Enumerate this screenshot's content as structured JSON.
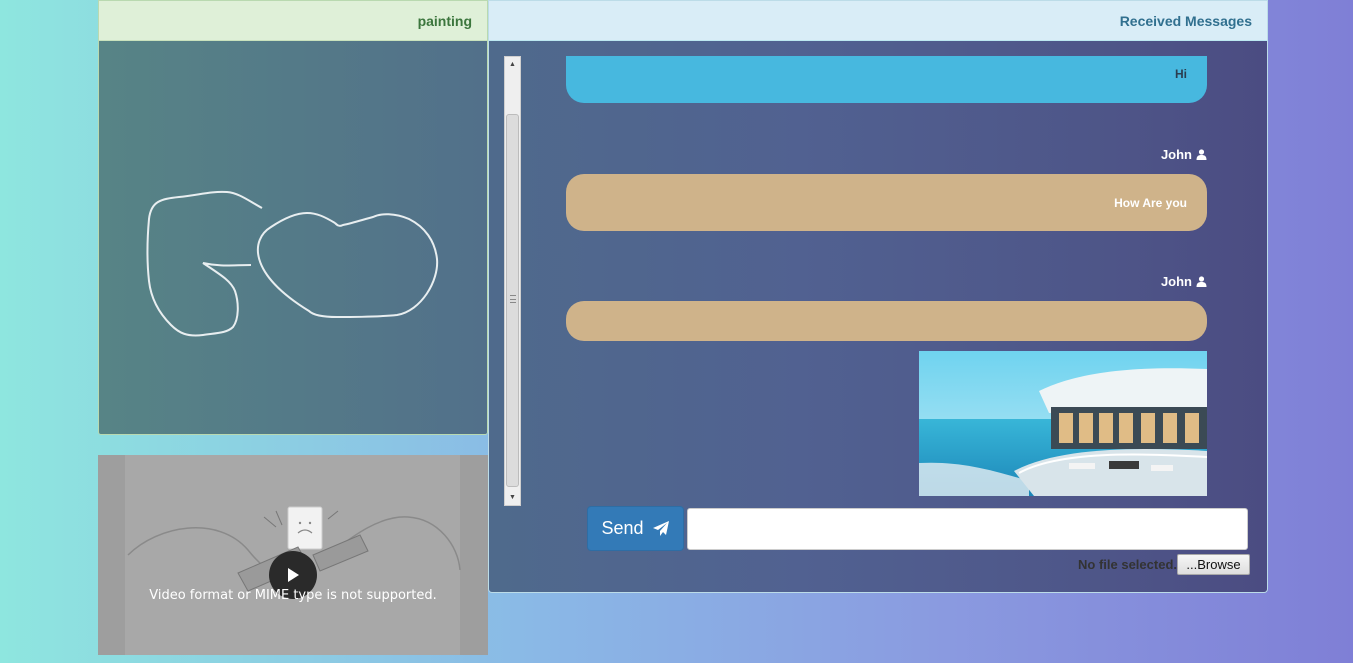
{
  "painting": {
    "title": "painting"
  },
  "video": {
    "error_message": "Video format or MIME type is not supported."
  },
  "messages": {
    "title": "Received Messages",
    "items": [
      {
        "text": "Hi",
        "style": "blue"
      },
      {
        "sender": "John",
        "text": "How Are you",
        "style": "tan"
      },
      {
        "sender": "John",
        "text": "",
        "style": "tan",
        "attachment": "image"
      }
    ]
  },
  "composer": {
    "send_label": "Send",
    "input_value": "",
    "file_status": "No file selected.",
    "browse_label": "...Browse"
  },
  "colors": {
    "send_button": "#337ab7",
    "painting_header_text": "#3c763d",
    "messages_header_text": "#31708f",
    "bubble_blue": "#47b8df",
    "bubble_tan": "#cfb38a"
  },
  "icons": {
    "sender": "user-icon",
    "send": "paper-plane-icon",
    "video": "play-icon"
  }
}
